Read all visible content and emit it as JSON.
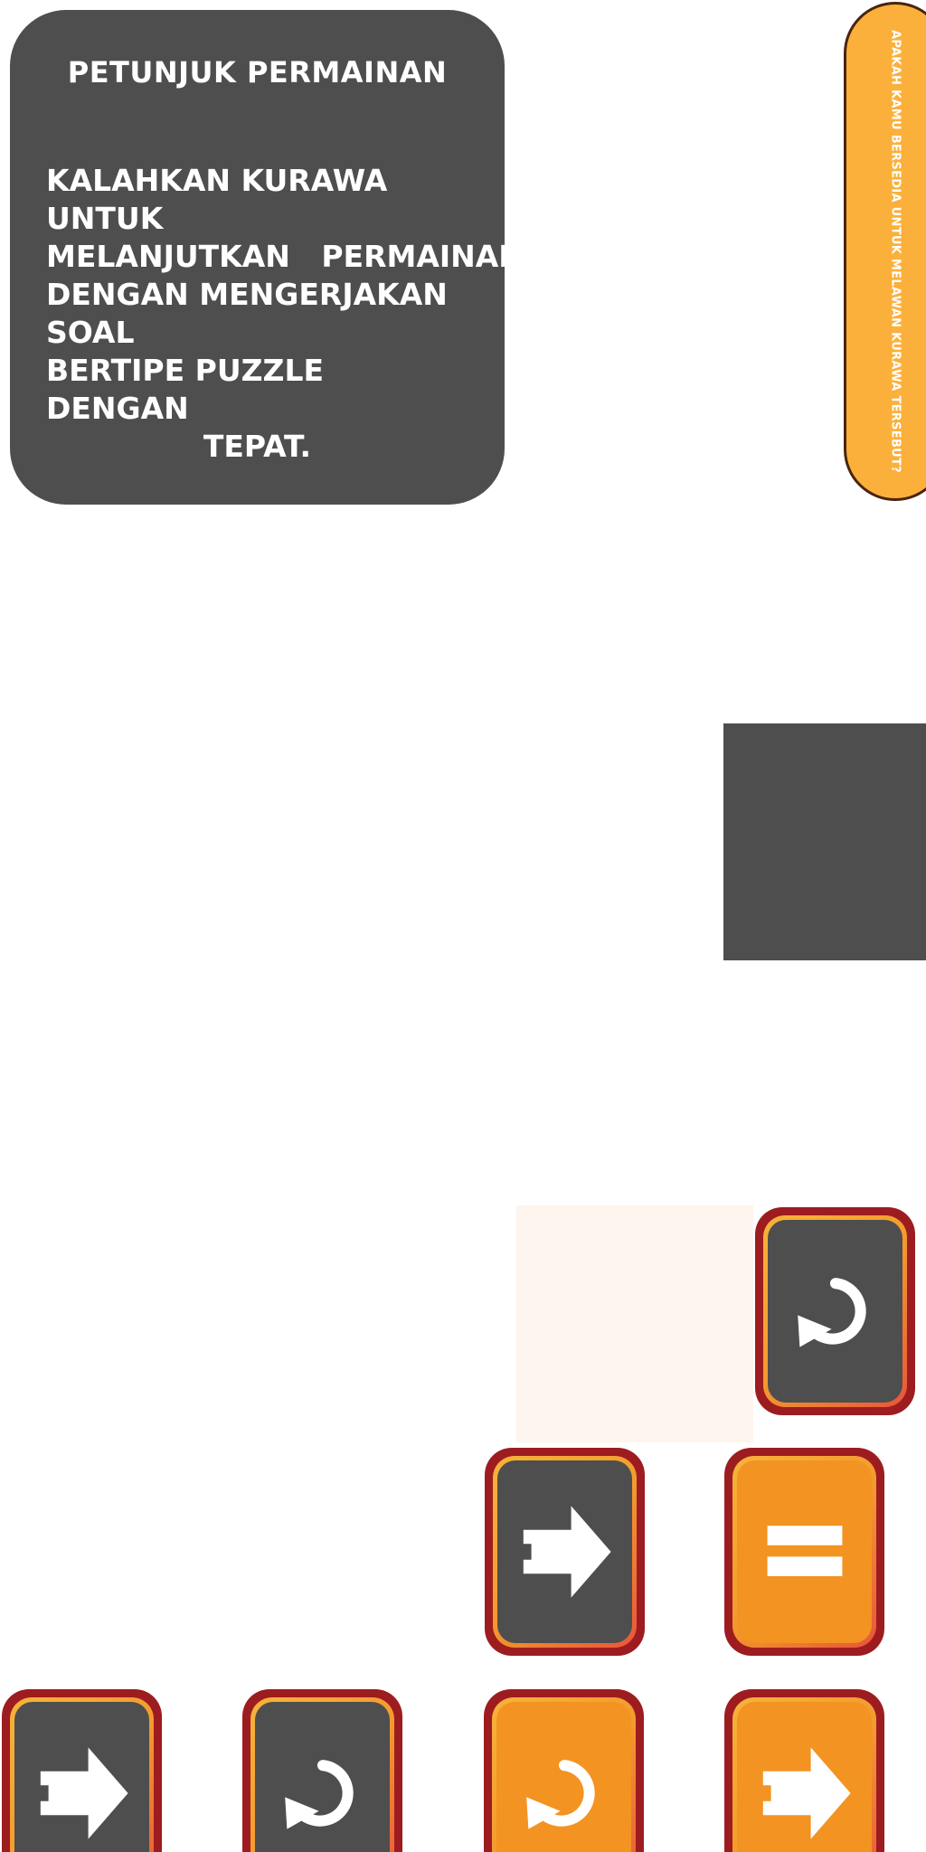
{
  "instructions": {
    "title": "PETUNJUK PERMAINAN",
    "lines": [
      "KALAHKAN KURAWA UNTUK",
      "MELANJUTKAN   PERMAINAN",
      "DENGAN MENGERJAKAN SOAL",
      "BERTIPE PUZZLE DENGAN",
      "TEPAT."
    ]
  },
  "question": {
    "text": "APAKAH KAMU BERSEDIA UNTUK MELAWAN KURAWA TERSEBUT?"
  },
  "colors": {
    "panel": "#4e4e4e",
    "pill": "#fbb03b",
    "pill_border": "#4a2410",
    "tile_frame": "#9d1c20",
    "tile_dark": "#4e4e4e",
    "tile_orange": "#f39322",
    "slot": "#fdf5ee"
  },
  "tiles": [
    {
      "icon": "rotate-icon",
      "style": "dark"
    },
    {
      "icon": "arrow-right-icon",
      "style": "dark"
    },
    {
      "icon": "equals-icon",
      "style": "orange"
    },
    {
      "icon": "arrow-right-icon",
      "style": "dark"
    },
    {
      "icon": "rotate-icon",
      "style": "dark"
    },
    {
      "icon": "rotate-icon",
      "style": "orange"
    },
    {
      "icon": "arrow-right-icon",
      "style": "orange"
    }
  ]
}
